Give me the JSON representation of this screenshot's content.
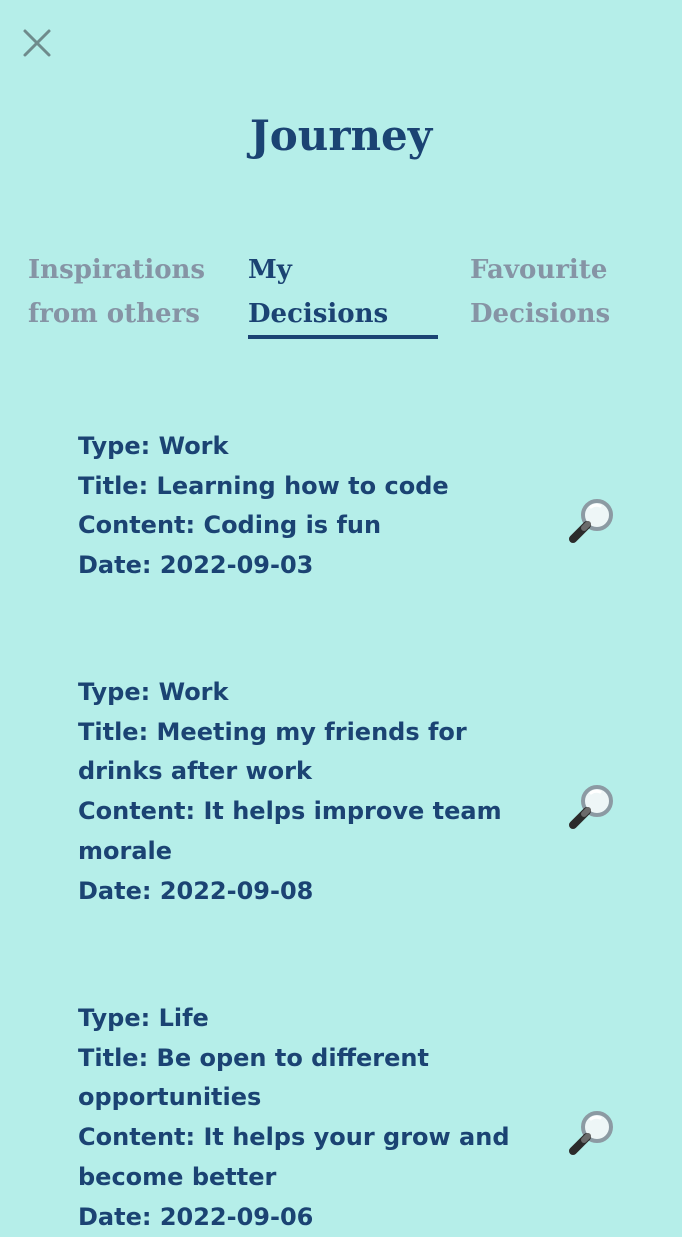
{
  "page": {
    "title": "Journey"
  },
  "icons": {
    "close": "close-icon",
    "view": "magnifier-icon"
  },
  "colors": {
    "background": "#b5eee9",
    "primary_text": "#1b4373",
    "inactive_tab": "#8694a5",
    "close_icon": "#6f8b8c"
  },
  "tabs": [
    {
      "line1": "Inspirations",
      "line2": "from others",
      "active": false
    },
    {
      "line1": "My",
      "line2": "Decisions",
      "active": true
    },
    {
      "line1": "Favourite",
      "line2": "Decisions",
      "active": false
    }
  ],
  "decisions": [
    {
      "type": "Type: Work",
      "title": "Title: Learning how to code",
      "content": "Content: Coding is fun",
      "date": "Date: 2022-09-03"
    },
    {
      "type": "Type: Work",
      "title": "Title: Meeting my friends for drinks after work",
      "content": "Content: It helps improve team morale",
      "date": "Date: 2022-09-08"
    },
    {
      "type": "Type: Life",
      "title": "Title: Be open to different opportunities",
      "content": "Content: It helps your grow and become better",
      "date": "Date: 2022-09-06"
    }
  ]
}
